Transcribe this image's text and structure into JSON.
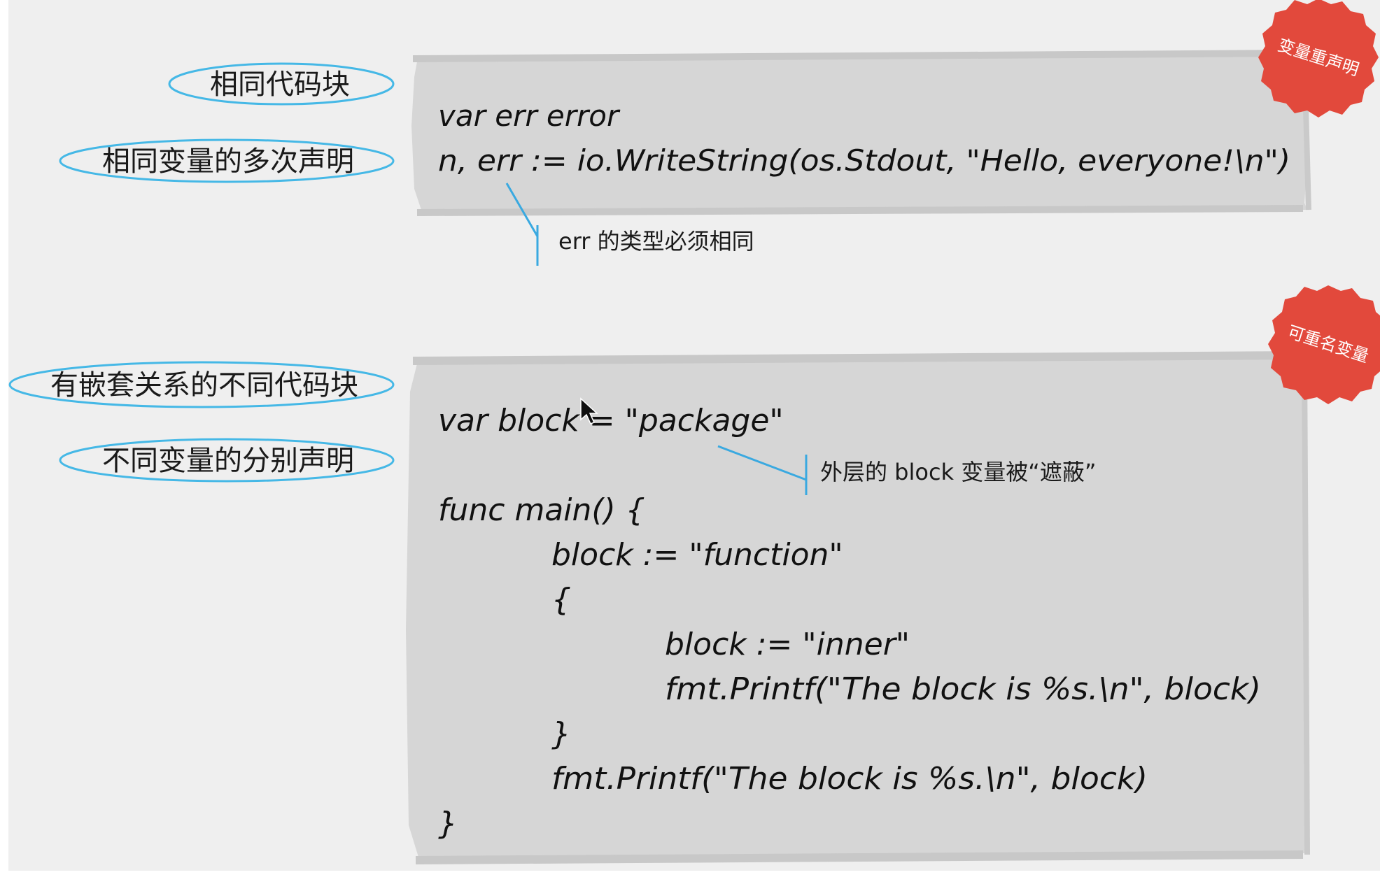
{
  "labels": {
    "same_block": "相同代码块",
    "same_var_multi_decl": "相同变量的多次声明",
    "nested_blocks": "有嵌套关系的不同代码块",
    "diff_var_separate_decl": "不同变量的分别声明"
  },
  "stamps": {
    "redeclare": "变量重声明",
    "rename": "可重名变量"
  },
  "code_top": {
    "line1": "var err error",
    "line2": "n, err := io.WriteString(os.Stdout, \"Hello, everyone!\\n\")"
  },
  "code_bottom": {
    "line1": "var block = \"package\"",
    "line2": "func main() {",
    "line3": "block := \"function\"",
    "line4": "{",
    "line5": "block := \"inner\"",
    "line6": "fmt.Printf(\"The block is %s.\\n\", block)",
    "line7": "}",
    "line8": "fmt.Printf(\"The block is %s.\\n\", block)",
    "line9": "}"
  },
  "notes": {
    "err_same_type": "err 的类型必须相同",
    "outer_block_shadowed": "外层的 block 变量被“遮蔽”"
  },
  "colors": {
    "ellipse_stroke": "#45b8e6",
    "stamp_fill": "#e2493c",
    "panel_fill": "#d6d6d6",
    "connector": "#3aa9e0"
  }
}
